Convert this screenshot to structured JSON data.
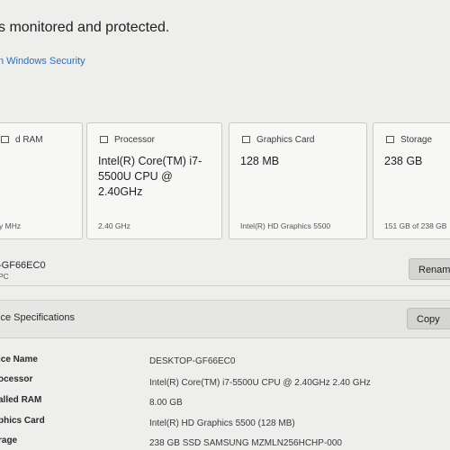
{
  "header": {
    "title": "s monitored and protected.",
    "security_link": "n Windows Security"
  },
  "cards": {
    "ram": {
      "title": "d RAM",
      "value": "",
      "sub": "y MHz",
      "icon": "ram-icon"
    },
    "processor": {
      "title": "Processor",
      "value": "Intel(R) Core(TM) i7-5500U CPU @ 2.40GHz",
      "sub": "2.40 GHz",
      "icon": "processor-icon"
    },
    "graphics": {
      "title": "Graphics Card",
      "value": "128 MB",
      "sub": "Intel(R) HD Graphics 5500",
      "icon": "graphics-card-icon"
    },
    "storage": {
      "title": "Storage",
      "value": "238 GB",
      "sub": "151 GB of 238 GB",
      "icon": "storage-icon"
    }
  },
  "device": {
    "name": "-GF66EC0",
    "type": "PC",
    "rename_label": "Renam"
  },
  "specs": {
    "title": "ice Specifications",
    "copy_label": "Copy",
    "rows": [
      {
        "label": "ice Name",
        "value": "DESKTOP-GF66EC0"
      },
      {
        "label": "ocessor",
        "value": "Intel(R) Core(TM) i7-5500U CPU @ 2.40GHz   2.40 GHz"
      },
      {
        "label": "alled RAM",
        "value": "8.00 GB"
      },
      {
        "label": "phics Card",
        "value": "Intel(R) HD Graphics 5500 (128 MB)"
      },
      {
        "label": "rage",
        "value": "238 GB SSD SAMSUNG MZMLN256HCHP-000"
      }
    ]
  }
}
